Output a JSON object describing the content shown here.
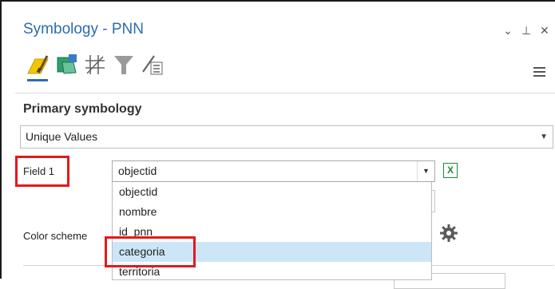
{
  "pane": {
    "title": "Symbology - PNN",
    "controls": {
      "collapse": "⌄",
      "pin": "⊥",
      "close": "✕"
    }
  },
  "toolbar": {
    "tools": [
      {
        "name": "primary-symbology",
        "icon": "paintbrush-icon",
        "active": true
      },
      {
        "name": "vary-symbology",
        "icon": "polygon-layers-icon",
        "active": false
      },
      {
        "name": "symbol-layer-drawing",
        "icon": "grid-order-icon",
        "active": false
      },
      {
        "name": "feature-filter",
        "icon": "funnel-icon",
        "active": false
      },
      {
        "name": "display-filters",
        "icon": "pen-list-icon",
        "active": false
      }
    ],
    "menu_icon": "hamburger-icon"
  },
  "primary": {
    "heading": "Primary symbology",
    "renderer": "Unique Values"
  },
  "field": {
    "label": "Field 1",
    "value": "objectid",
    "options": [
      "objectid",
      "nombre",
      "id_pnn",
      "categoria",
      "territoria"
    ],
    "hovered": "categoria"
  },
  "color_scheme": {
    "label": "Color scheme",
    "icon": "gear-icon"
  },
  "colors": {
    "accent": "#2d6db0",
    "highlight_box": "#e3191c",
    "selected_item": "#cce6f7"
  }
}
